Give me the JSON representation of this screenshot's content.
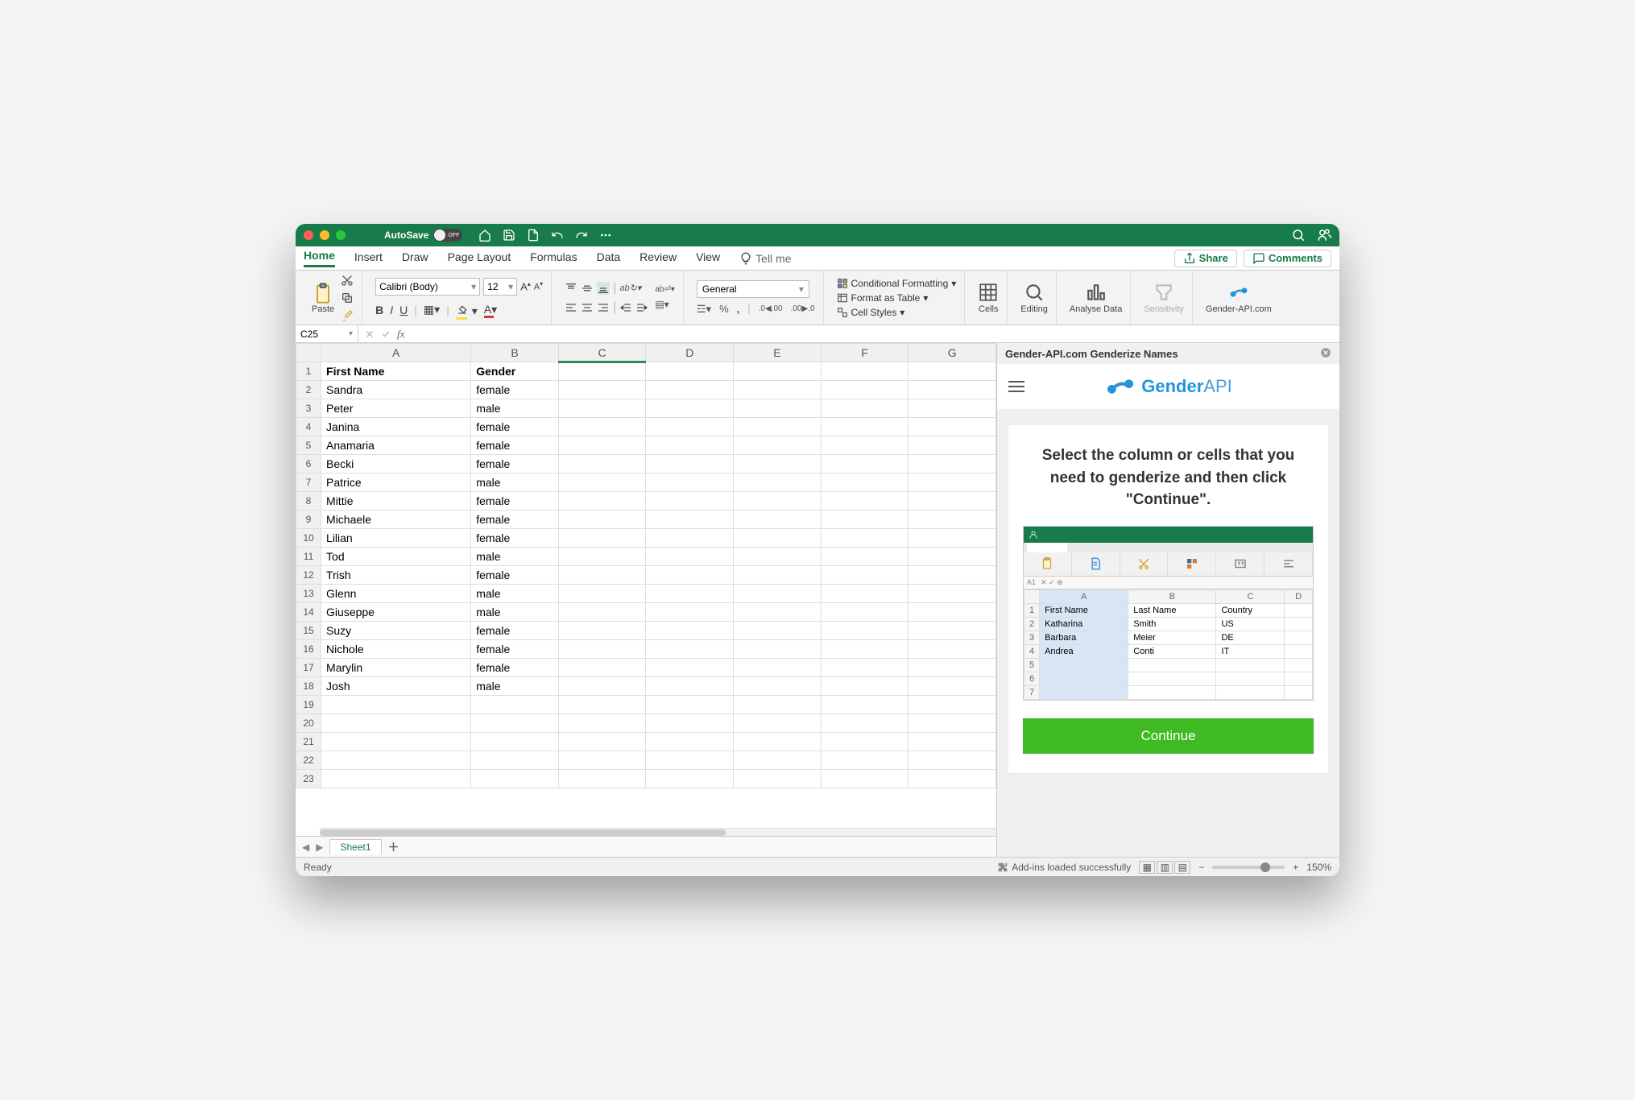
{
  "titlebar": {
    "autosave_label": "AutoSave",
    "autosave_state": "OFF"
  },
  "menubar": {
    "tabs": [
      "Home",
      "Insert",
      "Draw",
      "Page Layout",
      "Formulas",
      "Data",
      "Review",
      "View"
    ],
    "tell_me": "Tell me",
    "share": "Share",
    "comments": "Comments"
  },
  "ribbon": {
    "paste": "Paste",
    "font_name": "Calibri (Body)",
    "font_size": "12",
    "number_format": "General",
    "cond_format": "Conditional Formatting",
    "format_table": "Format as Table",
    "cell_styles": "Cell Styles",
    "cells": "Cells",
    "editing": "Editing",
    "analyse": "Analyse Data",
    "sensitivity": "Sensitivity",
    "addin": "Gender-API.com"
  },
  "fx": {
    "namebox": "C25"
  },
  "columns": [
    "A",
    "B",
    "C",
    "D",
    "E",
    "F",
    "G"
  ],
  "headers": {
    "a": "First Name",
    "b": "Gender"
  },
  "rows": [
    {
      "a": "Sandra",
      "b": "female"
    },
    {
      "a": "Peter",
      "b": "male"
    },
    {
      "a": "Janina",
      "b": "female"
    },
    {
      "a": "Anamaria",
      "b": "female"
    },
    {
      "a": "Becki",
      "b": "female"
    },
    {
      "a": "Patrice",
      "b": "male"
    },
    {
      "a": "Mittie",
      "b": "female"
    },
    {
      "a": "Michaele",
      "b": "female"
    },
    {
      "a": "Lilian",
      "b": "female"
    },
    {
      "a": "Tod",
      "b": "male"
    },
    {
      "a": "Trish",
      "b": "female"
    },
    {
      "a": "Glenn",
      "b": "male"
    },
    {
      "a": "Giuseppe",
      "b": "male"
    },
    {
      "a": "Suzy",
      "b": "female"
    },
    {
      "a": "Nichole",
      "b": "female"
    },
    {
      "a": "Marylin",
      "b": "female"
    },
    {
      "a": "Josh",
      "b": "male"
    }
  ],
  "blank_rows": 5,
  "sheets": {
    "active": "Sheet1"
  },
  "status": {
    "ready": "Ready",
    "addins": "Add-ins loaded successfully",
    "zoom": "150%"
  },
  "pane": {
    "title": "Gender-API.com Genderize Names",
    "brand_strong": "Gender",
    "brand_thin": "API",
    "heading": "Select the column or cells that you need to genderize and then click \"Continue\".",
    "mini_fx": "A1",
    "mini_cols": [
      "A",
      "B",
      "C",
      "D"
    ],
    "mini_head": {
      "a": "First Name",
      "b": "Last Name",
      "c": "Country"
    },
    "mini_rows": [
      {
        "a": "Katharina",
        "b": "Smith",
        "c": "US"
      },
      {
        "a": "Barbara",
        "b": "Meier",
        "c": "DE"
      },
      {
        "a": "Andrea",
        "b": "Conti",
        "c": "IT"
      }
    ],
    "continue": "Continue"
  }
}
